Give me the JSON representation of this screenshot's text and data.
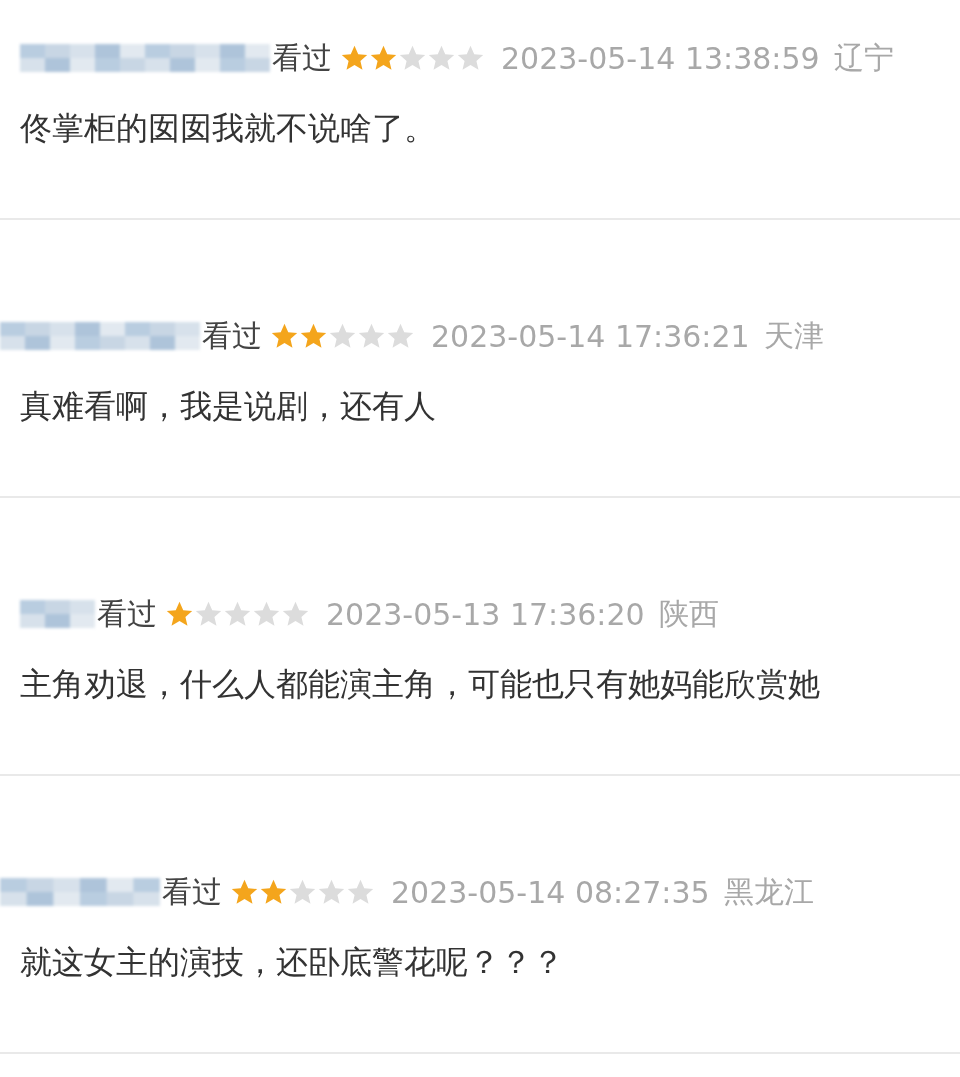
{
  "comments": [
    {
      "status": "看过",
      "stars": 2,
      "time": "2023-05-14 13:38:59",
      "location": "辽宁",
      "text": "佟掌柜的囡囡我就不说啥了。"
    },
    {
      "status": "看过",
      "stars": 2,
      "time": "2023-05-14 17:36:21",
      "location": "天津",
      "text": "真难看啊，我是说剧，还有人"
    },
    {
      "status": "看过",
      "stars": 1,
      "time": "2023-05-13 17:36:20",
      "location": "陕西",
      "text": "主角劝退，什么人都能演主角，可能也只有她妈能欣赏她"
    },
    {
      "status": "看过",
      "stars": 2,
      "time": "2023-05-14 08:27:35",
      "location": "黑龙江",
      "text": "就这女主的演技，还卧底警花呢？？？"
    }
  ]
}
